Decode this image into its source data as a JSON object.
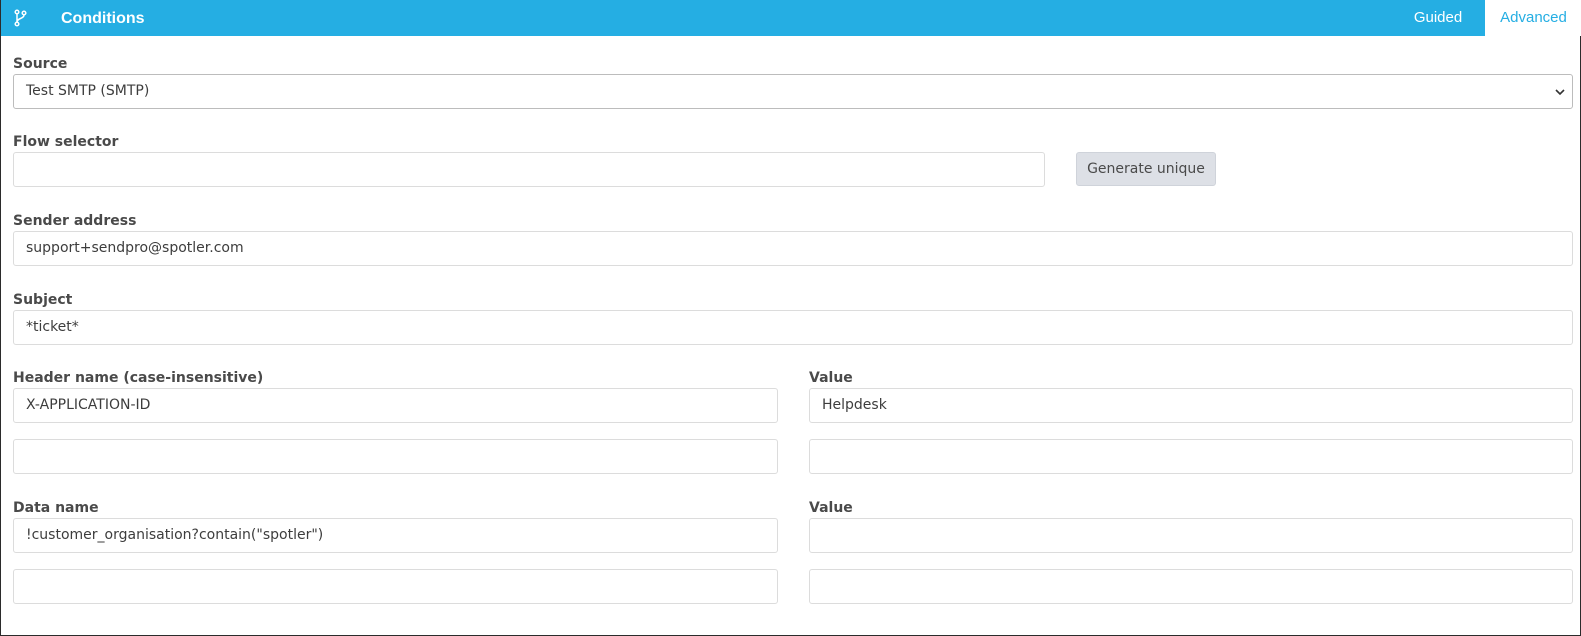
{
  "header": {
    "title": "Conditions",
    "icon": "flow-branch-icon",
    "tabs": [
      {
        "label": "Guided",
        "active": false
      },
      {
        "label": "Advanced",
        "active": true
      }
    ],
    "colors": {
      "bar": "#25aee3",
      "active_tab_text": "#25aee3"
    }
  },
  "form": {
    "source": {
      "label": "Source",
      "value": "Test SMTP (SMTP)"
    },
    "flow_selector": {
      "label": "Flow selector",
      "value": "",
      "button_label": "Generate unique"
    },
    "sender_address": {
      "label": "Sender address",
      "value": "support+sendpro@spotler.com"
    },
    "subject": {
      "label": "Subject",
      "value": "*ticket*"
    },
    "headers": {
      "name_label": "Header name (case-insensitive)",
      "value_label": "Value",
      "rows": [
        {
          "name": "X-APPLICATION-ID",
          "value": "Helpdesk"
        },
        {
          "name": "",
          "value": ""
        }
      ]
    },
    "data": {
      "name_label": "Data name",
      "value_label": "Value",
      "rows": [
        {
          "name": "!customer_organisation?contain(\"spotler\")",
          "value": ""
        },
        {
          "name": "",
          "value": ""
        }
      ]
    }
  }
}
